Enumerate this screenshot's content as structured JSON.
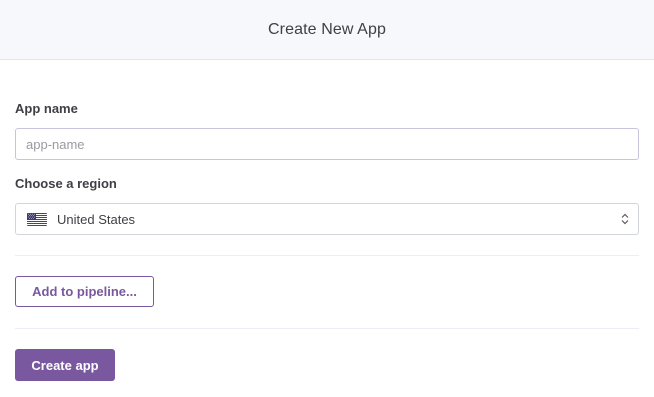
{
  "header": {
    "title": "Create New App"
  },
  "form": {
    "app_name": {
      "label": "App name",
      "placeholder": "app-name",
      "value": ""
    },
    "region": {
      "label": "Choose a region",
      "selected": "United States",
      "flag_icon": "us-flag-icon"
    },
    "pipeline_button_label": "Add to pipeline...",
    "create_button_label": "Create app"
  },
  "colors": {
    "accent": "#79589f",
    "header_bg": "#f7f8fb",
    "text": "#3f3f44"
  }
}
